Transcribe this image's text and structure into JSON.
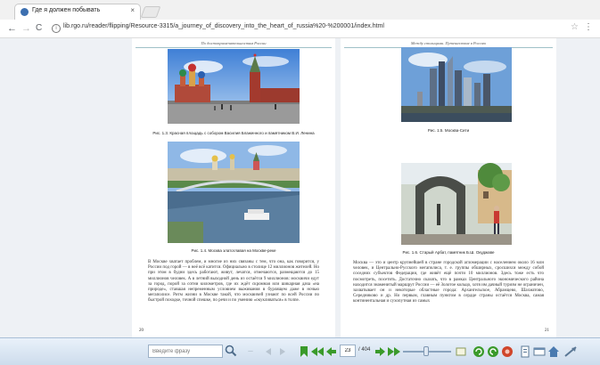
{
  "browser": {
    "tab_title": "Где я должен побывать",
    "tab_close": "×",
    "url": "lib.rgo.ru/reader/flipping/Resource-3315/a_journey_of_discovery_into_the_heart_of_russia%20-%200001/index.html",
    "url_icon": "i",
    "nav": {
      "back": "←",
      "forward": "→",
      "reload": "C"
    },
    "star": "☆",
    "menu": "⋮"
  },
  "left_page": {
    "running_head": "По достопримечательностям России",
    "caption_top": "Рис. 1.3. Красная площадь с собором Василия Блаженного и памятником В.И. Ленина",
    "caption_bottom": "Рис. 1.4. Москва златоглавая на Москве-реке",
    "body": "В Москве хватает проблем, и многие из них связаны с тем, что она, как говорится, у России под горой — в неё всё катится. Официально в столице 12 миллионов жителей. Но при этом в будни здесь работают, живут, лечатся, отмечаются, размещаются до 15 миллионов человек. А в летний выходной день из остаётся 9 миллионов: москвичи едут за город, порой за сотни километров, где их ждёт скромная или шикарная дача «на природе», ставшая непременным условием выживания в бурлящем даже в ночью мегаполисе. Ритм жизни в Москве такой, что москвичей узнают по всей России по быстрой походке, точной спешке, по речи и по умению «окукливаться» в толпе.",
    "page_number": "20"
  },
  "right_page": {
    "running_head": "Между столицами. Путешествие в Россию",
    "caption_top": "Рис. 1.5. Москва-Сити",
    "caption_bottom": "Рис. 1.6. Старый Арбат, памятник Б.Ш. Окуджаве",
    "body": "Москва — это и центр крупнейшей в стране городской агломерации с населением около 16 млн человек, и Центрально-Русского мегаполиса, т. е. группы обширных, сросшихся между собой соседних субъектов Федерации, где живёт ещё почти 10 миллионов. Здесь тоже есть что посмотреть, посетить. Достаточно сказать, что в рамках Центрального экономического района находится знаменитый маршрут России — её Золотое кольцо, хотя им дачный туризм не ограничен, захватывает он и некоторые областные города: Архангельское, Абрамцево, Шахматово, Середниково и др. Но первым, главным пунктом в сердце страны остаётся Москва, самая континентальная и сухопутная из самых",
    "page_number": "21"
  },
  "toolbar": {
    "search_placeholder": "Введите фразу",
    "current_page": "23",
    "total_pages": "/ 404"
  },
  "colors": {
    "accent_green": "#3a9a2a",
    "toolbar_blue": "#cddcec",
    "header_rule": "#9fc1c8"
  }
}
